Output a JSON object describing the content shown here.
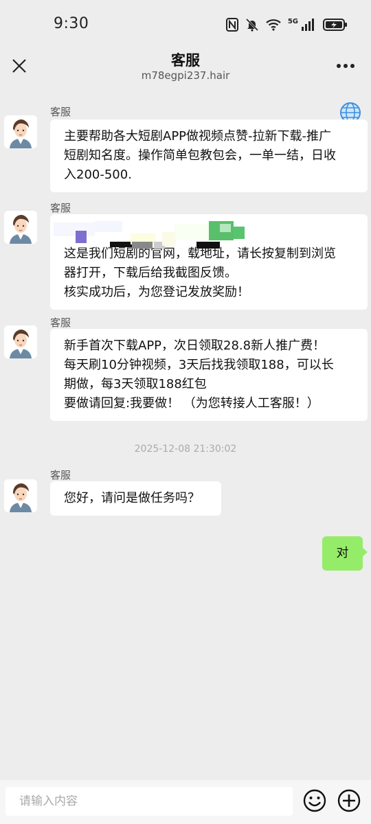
{
  "status_bar": {
    "time": "9:30",
    "network": "5G",
    "icons": [
      "nfc-icon",
      "bell-off-icon",
      "wifi-icon",
      "signal-icon",
      "battery-charging-icon"
    ]
  },
  "header": {
    "title": "客服",
    "subtitle": "m78egpi237.hair",
    "left_icon": "close-icon",
    "right_icon": "more-icon"
  },
  "messages": [
    {
      "sender": "客服",
      "lines": [
        "主要帮助各大短剧APP做视频点赞-拉新下载-推广",
        "短剧知名度。操作简单包教包会，一单一结，日收",
        "入200-500."
      ]
    },
    {
      "sender": "客服",
      "lines": [
        "这是我们短剧的官网，载地址，请长按复制到浏览",
        "器打开，下载后给我截图反馈。",
        "核实成功后，为您登记发放奖励！"
      ]
    },
    {
      "sender": "客服",
      "lines": [
        "新手首次下载APP，次日领取28.8新人推广费！",
        "每天刷10分钟视频，3天后找我领取188，可以长",
        "期做，每3天领取188红包",
        "要做请回复:我要做！   （为您转接人工客服！）"
      ]
    },
    {
      "sender": "客服",
      "lines": [
        "您好，请问是做任务吗？"
      ]
    }
  ],
  "timestamp": "2025-12-08 21:30:02",
  "self_message": "对",
  "input": {
    "placeholder": "请输入内容",
    "value": ""
  },
  "colors": {
    "background": "#ededed",
    "self_bubble": "#95ec69",
    "other_bubble": "#ffffff"
  }
}
